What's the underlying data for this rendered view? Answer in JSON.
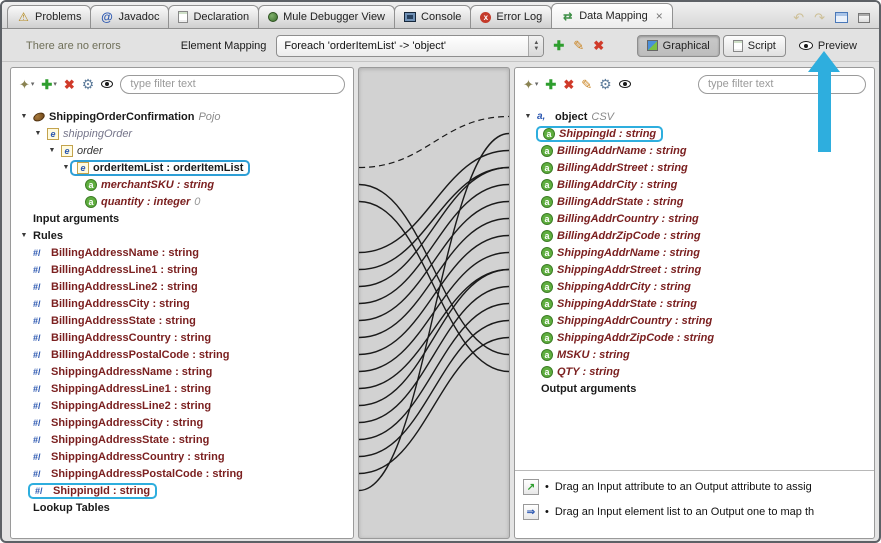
{
  "icons": {
    "expanded": "▼",
    "dropdown": "▾",
    "add": "✚",
    "delete": "✖",
    "edit": "✎",
    "gear": "⚙",
    "wand": "✦",
    "warning": "⚠",
    "at": "@",
    "undo": "↶",
    "redo": "↷",
    "close": "×",
    "swap": "⇄",
    "bullet": "•",
    "element": "e",
    "attr": "a",
    "attr_obj": "a,",
    "rule": "#/",
    "err": "x",
    "hint_assign": "↗",
    "hint_map": "⇒",
    "step_up": "▲",
    "step_down": "▼"
  },
  "tabs": [
    {
      "label": "Problems"
    },
    {
      "label": "Javadoc"
    },
    {
      "label": "Declaration"
    },
    {
      "label": "Mule Debugger View"
    },
    {
      "label": "Console"
    },
    {
      "label": "Error Log"
    },
    {
      "label": "Data Mapping",
      "active": true
    }
  ],
  "toolbar": {
    "status_text": "There are no errors",
    "element_mapping_label": "Element Mapping",
    "foreach_value": "Foreach 'orderItemList' -> 'object'",
    "views": {
      "graphical": "Graphical",
      "script": "Script",
      "preview": "Preview"
    }
  },
  "left_panel": {
    "filter_placeholder": "type filter text",
    "tree": {
      "root_label": "ShippingOrderConfirmation",
      "root_type": "Pojo",
      "shipping_order": "shippingOrder",
      "order": "order",
      "order_item_list": "orderItemList : orderItemList",
      "merchant_sku": "merchantSKU : string",
      "quantity": "quantity : integer",
      "quantity_default": "0",
      "input_arguments": "Input arguments",
      "rules_header": "Rules",
      "rules": [
        "BillingAddressName : string",
        "BillingAddressLine1 : string",
        "BillingAddressLine2 : string",
        "BillingAddressCity : string",
        "BillingAddressState : string",
        "BillingAddressCountry : string",
        "BillingAddressPostalCode : string",
        "ShippingAddressName : string",
        "ShippingAddressLine1 : string",
        "ShippingAddressLine2 : string",
        "ShippingAddressCity : string",
        "ShippingAddressState : string",
        "ShippingAddressCountry : string",
        "ShippingAddressPostalCode : string",
        "ShippingId : string"
      ],
      "lookup_tables": "Lookup Tables"
    }
  },
  "right_panel": {
    "filter_placeholder": "type filter text",
    "tree": {
      "root_label": "object",
      "root_type": "CSV",
      "attributes": [
        "ShippingId : string",
        "BillingAddrName : string",
        "BillingAddrStreet : string",
        "BillingAddrCity : string",
        "BillingAddrState : string",
        "BillingAddrCountry : string",
        "BillingAddrZipCode : string",
        "ShippingAddrName : string",
        "ShippingAddrStreet : string",
        "ShippingAddrCity : string",
        "ShippingAddrState : string",
        "ShippingAddrCountry : string",
        "ShippingAddrZipCode : string",
        "MSKU : string",
        "QTY : string"
      ],
      "output_arguments": "Output arguments"
    },
    "hints": [
      "Drag an Input attribute to an Output attribute to assig",
      "Drag an Input element list to an Output one to map th"
    ]
  },
  "mappings": [
    {
      "from": "in-orderItemList",
      "to": "out-object",
      "dashed": true
    },
    {
      "from": "in-merchantSKU",
      "to": "out-MSKU"
    },
    {
      "from": "in-quantity",
      "to": "out-QTY"
    },
    {
      "from": "in-BillingAddressName",
      "to": "out-BillingAddrName"
    },
    {
      "from": "in-BillingAddressLine1",
      "to": "out-BillingAddrStreet"
    },
    {
      "from": "in-BillingAddressLine2",
      "to": "out-BillingAddrStreet"
    },
    {
      "from": "in-BillingAddressCity",
      "to": "out-BillingAddrCity"
    },
    {
      "from": "in-BillingAddressState",
      "to": "out-BillingAddrState"
    },
    {
      "from": "in-BillingAddressCountry",
      "to": "out-BillingAddrCountry"
    },
    {
      "from": "in-BillingAddressPostalCode",
      "to": "out-BillingAddrZipCode"
    },
    {
      "from": "in-ShippingAddressName",
      "to": "out-ShippingAddrName"
    },
    {
      "from": "in-ShippingAddressLine1",
      "to": "out-ShippingAddrStreet"
    },
    {
      "from": "in-ShippingAddressLine2",
      "to": "out-ShippingAddrStreet"
    },
    {
      "from": "in-ShippingAddressCity",
      "to": "out-ShippingAddrCity"
    },
    {
      "from": "in-ShippingAddressState",
      "to": "out-ShippingAddrState"
    },
    {
      "from": "in-ShippingAddressCountry",
      "to": "out-ShippingAddrCountry"
    },
    {
      "from": "in-ShippingAddressPostalCode",
      "to": "out-ShippingAddrZipCode"
    },
    {
      "from": "in-ShippingId",
      "to": "out-ShippingId"
    }
  ],
  "colors": {
    "line": "#1a1a1a",
    "annotation": "#2eaede",
    "rule_text": "#7b2020",
    "attr_green": "#5fae3f"
  }
}
